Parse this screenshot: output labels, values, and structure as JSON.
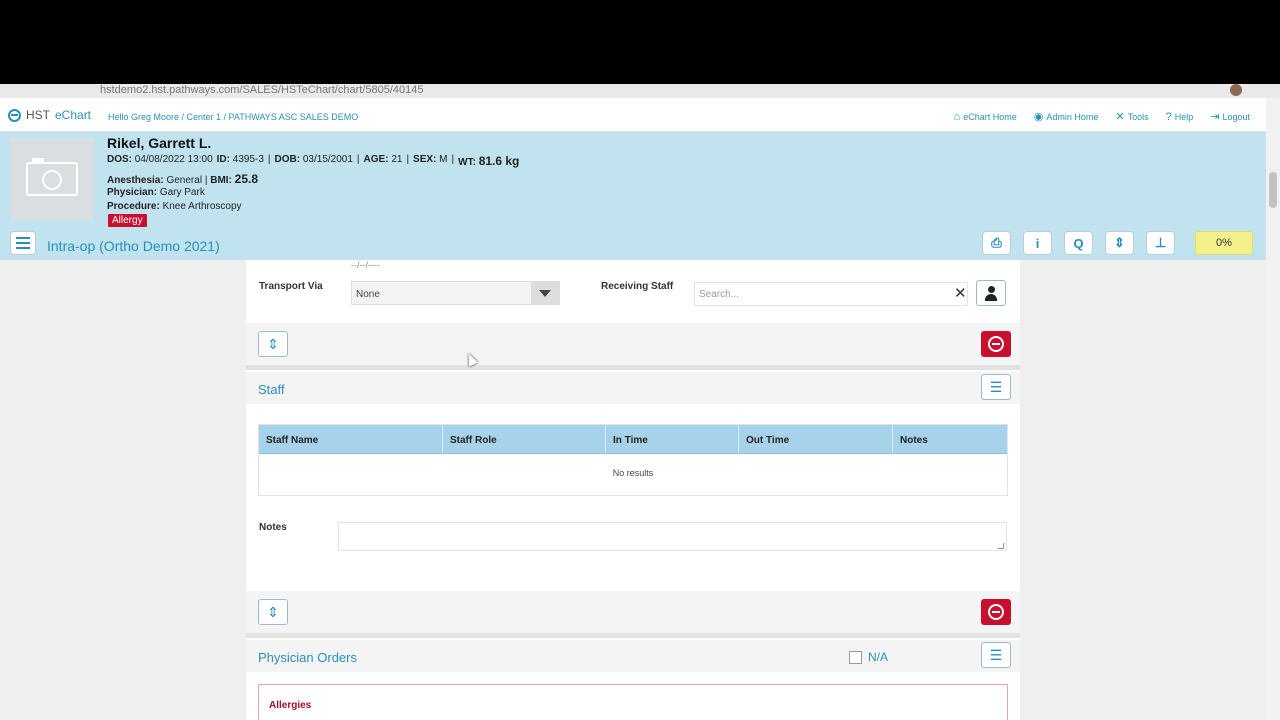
{
  "browser": {
    "url": "hstdemo2.hst.pathways.com/SALES/HSTeChart/chart/5805/40145"
  },
  "app": {
    "logo_hst": "HST",
    "logo_echart": "eChart",
    "greeting": "Hello Greg Moore / Center 1 / PATHWAYS ASC SALES DEMO",
    "nav": [
      {
        "label": "eChart Home",
        "icon": "home-icon"
      },
      {
        "label": "Admin Home",
        "icon": "admin-icon"
      },
      {
        "label": "Tools",
        "icon": "tools-icon"
      },
      {
        "label": "Help",
        "icon": "help-icon"
      },
      {
        "label": "Logout",
        "icon": "logout-icon"
      }
    ]
  },
  "patient": {
    "name": "Rikel, Garrett L.",
    "dos_label": "DOS:",
    "dos": "04/08/2022 13:00",
    "id_label": "ID:",
    "id": "4395-3",
    "dob_label": "DOB:",
    "dob": "03/15/2001",
    "age_label": "AGE:",
    "age": "21",
    "sex_label": "SEX:",
    "sex": "M",
    "wt_label": "WT:",
    "wt": "81.6 kg",
    "anesthesia_label": "Anesthesia:",
    "anesthesia": "General",
    "bmi_label": "BMI:",
    "bmi": "25.8",
    "physician_label": "Physician:",
    "physician": "Gary Park",
    "procedure_label": "Procedure:",
    "procedure": "Knee Arthroscopy",
    "allergy_badge": "Allergy",
    "sep": "|"
  },
  "toolbar": {
    "case_title": "Intra-op (Ortho Demo 2021)",
    "progress": "0%",
    "buttons": [
      "print-icon",
      "info-icon",
      "search-icon",
      "collapse-icon",
      "pin-icon"
    ]
  },
  "transfer": {
    "date_placeholder": "--/--/----",
    "transport_label": "Transport Via",
    "transport_value": "None",
    "receiving_label": "Receiving Staff",
    "search_placeholder": "Search..."
  },
  "staff": {
    "title": "Staff",
    "columns": [
      "Staff Name",
      "Staff Role",
      "In Time",
      "Out Time",
      "Notes"
    ],
    "empty": "No results",
    "notes_label": "Notes"
  },
  "orders": {
    "title": "Physician Orders",
    "na_label": "N/A",
    "allergies_title": "Allergies"
  },
  "colors": {
    "accent": "#2a8fb8",
    "banner": "#c0e3ef",
    "danger": "#c8102e",
    "progress": "#f3f28a"
  }
}
